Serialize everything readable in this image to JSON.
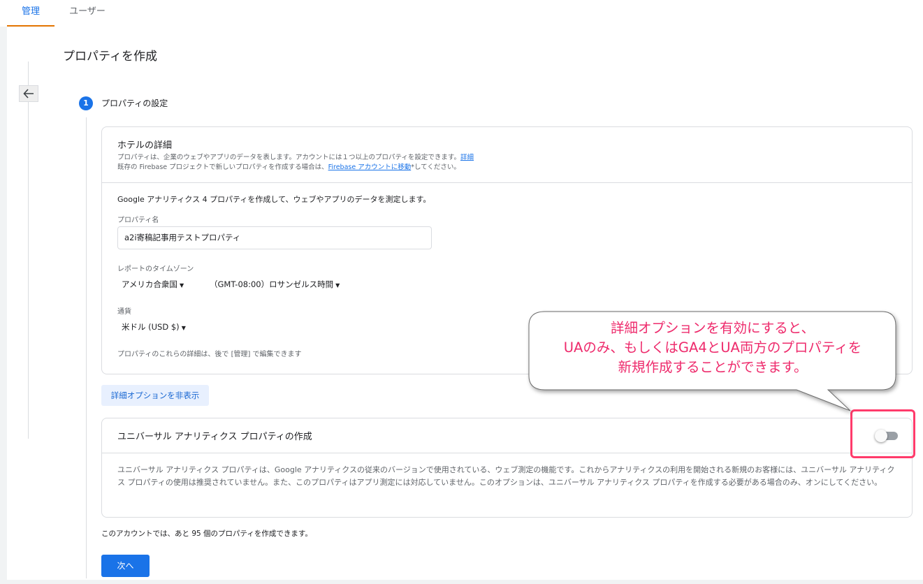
{
  "tabs": {
    "admin": "管理",
    "user": "ユーザー"
  },
  "page": {
    "title": "プロパティを作成"
  },
  "step": {
    "number": "1",
    "label": "プロパティの設定"
  },
  "hotel": {
    "title": "ホテルの詳細",
    "desc1": "プロパティは、企業のウェブやアプリのデータを表します。アカウントには１つ以上のプロパティを設定できます。",
    "desc1_link": "詳細",
    "desc2_pre": "既存の Firebase プロジェクトで新しいプロパティを作成する場合は、",
    "desc2_link": "Firebase アカウントに移動",
    "desc2_post": "してください。"
  },
  "form": {
    "ga4_text": "Google アナリティクス 4 プロパティを作成して、ウェブやアプリのデータを測定します。",
    "property_name_label": "プロパティ名",
    "property_name_value": "a2i寄稿記事用テストプロパティ",
    "timezone_label": "レポートのタイムゾーン",
    "country": "アメリカ合衆国",
    "timezone": "（GMT-08:00）ロサンゼルス時間",
    "currency_label": "通貨",
    "currency": "米ドル (USD $)",
    "note": "プロパティのこれらの詳細は、後で [管理] で編集できます"
  },
  "advanced": {
    "toggle_label": "詳細オプションを非表示"
  },
  "ua": {
    "title": "ユニバーサル アナリティクス プロパティの作成",
    "desc": "ユニバーサル アナリティクス プロパティは、Google アナリティクスの従来のバージョンで使用されている、ウェブ測定の機能です。これからアナリティクスの利用を開始される新規のお客様には、ユニバーサル アナリティクス プロパティの使用は推奨されていません。また、このプロパティはアプリ測定には対応していません。このオプションは、ユニバーサル アナリティクス プロパティを作成する必要がある場合のみ、オンにしてください。",
    "toggle_on": false
  },
  "remaining_text": "このアカウントでは、あと 95 個のプロパティを作成できます。",
  "next_button": "次へ",
  "callout": {
    "line1": "詳細オプションを有効にすると、",
    "line2": "UAのみ、もしくはGA4とUA両方のプロパティを",
    "line3": "新規作成することができます。",
    "color": "#ee2b6c"
  },
  "colors": {
    "accent": "#1a73e8",
    "tab_underline": "#e37400",
    "highlight": "#ff3b6b"
  }
}
